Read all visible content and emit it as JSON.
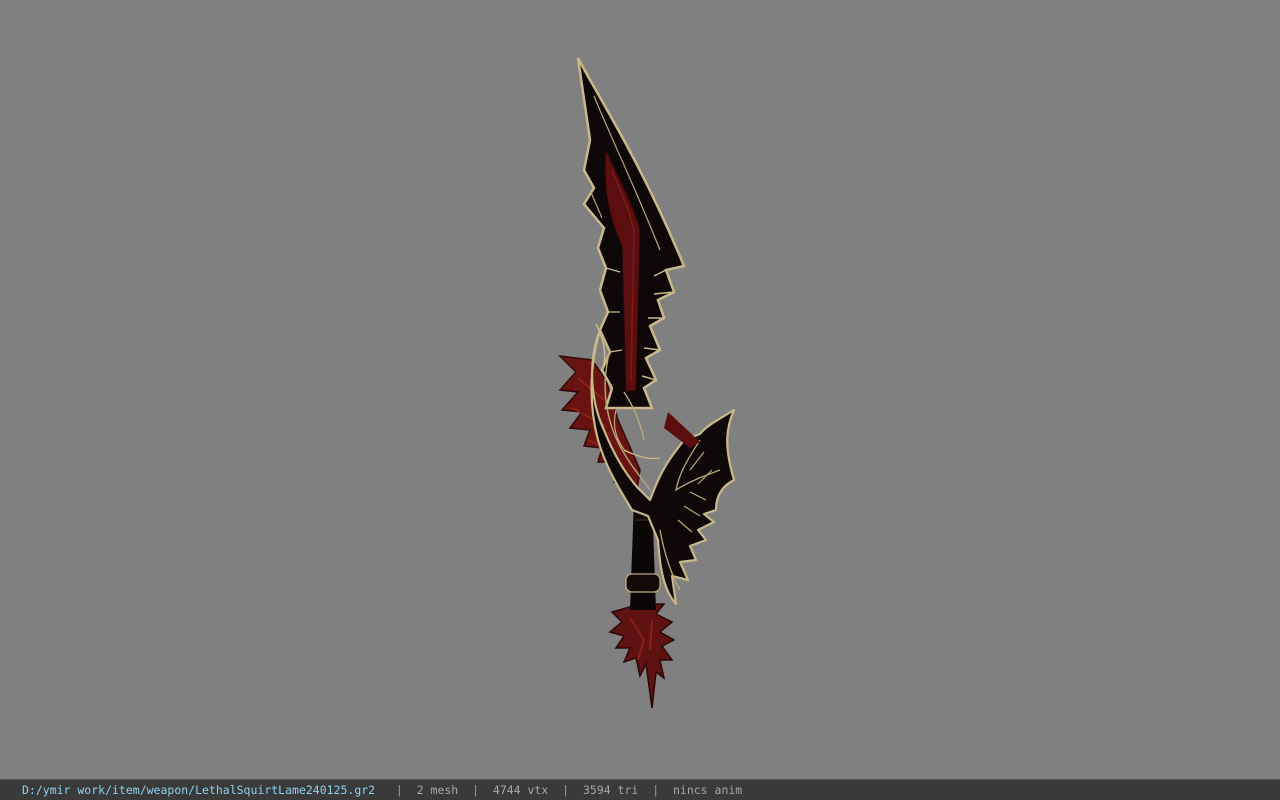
{
  "viewer": {
    "background_color": "#808080",
    "model": {
      "icon": "sword-model",
      "colors": {
        "blade": "#0d0807",
        "blood_channel": "#5a0f0e",
        "edge_trim": "#c9b98a",
        "feathers": "#6e1412"
      }
    }
  },
  "status_bar": {
    "file_path": "D:/ymir work/item/weapon/LethalSquirtLame240125.gr2",
    "separator": "|",
    "mesh_count": "2 mesh",
    "vertex_count": "4744 vtx",
    "triangle_count": "3594 tri",
    "animation": "nincs anim"
  }
}
